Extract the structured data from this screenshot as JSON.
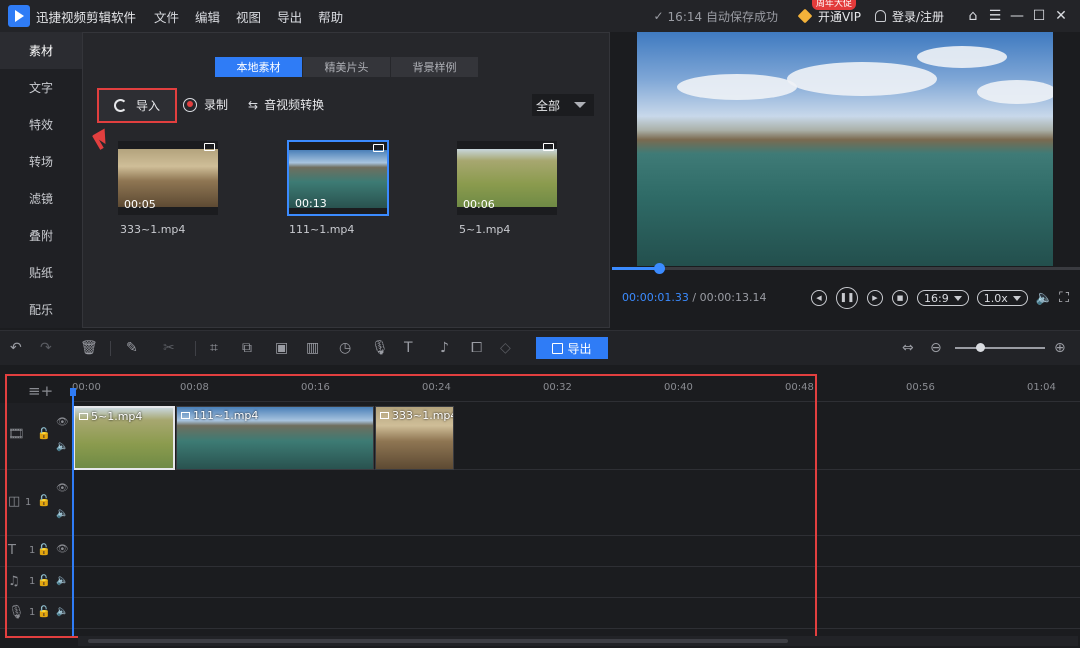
{
  "titlebar": {
    "app_name": "迅捷视频剪辑软件",
    "menu": [
      "文件",
      "编辑",
      "视图",
      "导出",
      "帮助"
    ],
    "save_status": "16:14 自动保存成功",
    "vip_label": "开通VIP",
    "vip_badge": "周年大促",
    "login_label": "登录/注册"
  },
  "leftnav": {
    "items": [
      "素材",
      "文字",
      "特效",
      "转场",
      "滤镜",
      "叠附",
      "贴纸",
      "配乐"
    ],
    "active_index": 0
  },
  "media": {
    "tabs": [
      "本地素材",
      "精美片头",
      "背景样例"
    ],
    "active_tab": 0,
    "import_label": "导入",
    "record_label": "录制",
    "convert_label": "音视频转换",
    "filter_value": "全部",
    "files": [
      {
        "name": "333~1.mp4",
        "duration": "00:05",
        "thumb": "desert"
      },
      {
        "name": "111~1.mp4",
        "duration": "00:13",
        "thumb": "lake",
        "selected": true
      },
      {
        "name": "5~1.mp4",
        "duration": "00:06",
        "thumb": "road"
      }
    ]
  },
  "preview": {
    "current_time": "00:00:01.33",
    "separator": " / ",
    "total_time": "00:00:13.14",
    "progress": 0.1,
    "aspect_ratio": "16:9",
    "speed": "1.0x"
  },
  "toolbar": {
    "export_label": "导出",
    "zoom_level": 0.28
  },
  "timeline": {
    "ticks": [
      "00:00",
      "00:08",
      "00:16",
      "00:24",
      "00:32",
      "00:40",
      "00:48",
      "00:56",
      "01:04"
    ],
    "clips": [
      {
        "name": "5~1.mp4",
        "thumb": "road",
        "selected": true
      },
      {
        "name": "111~1.mp4",
        "thumb": "lake"
      },
      {
        "name": "333~1.mp4",
        "thumb": "desert"
      }
    ],
    "track_numbers": [
      "1",
      "1",
      "1",
      "1"
    ]
  },
  "colors": {
    "accent": "#2f7cf6",
    "highlight_red": "#e23f3f",
    "panel": "#26272b",
    "background": "#1b1c1f"
  }
}
